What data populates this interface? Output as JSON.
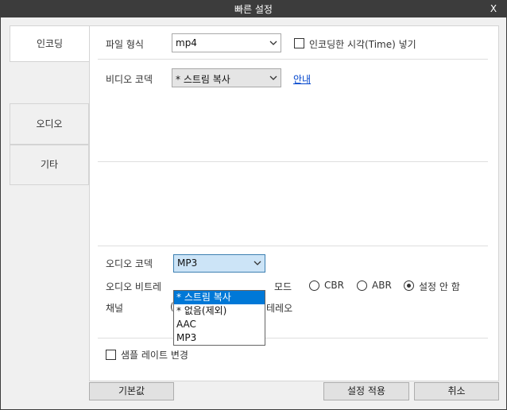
{
  "window": {
    "title": "빠른 설정",
    "close_label": "X"
  },
  "tabs": {
    "encoding": "인코딩",
    "audio": "오디오",
    "other": "기타"
  },
  "encoding": {
    "file_format_label": "파일 형식",
    "file_format_value": "mp4",
    "insert_time_label": "인코딩한 시각(Time) 넣기",
    "video_codec_label": "비디오 코덱",
    "video_codec_value": "* 스트림 복사",
    "guide_link": "안내"
  },
  "audio": {
    "codec_label": "오디오 코덱",
    "codec_value": "MP3",
    "codec_options": [
      "* 스트림 복사",
      "* 없음(제외)",
      "AAC",
      "MP3"
    ],
    "bitrate_label": "오디오 비트레",
    "mode_label": "모드",
    "mode_options": {
      "cbr": "CBR",
      "abr": "ABR",
      "none": "설정 안 함"
    },
    "mode_selected": "설정 안 함",
    "channel_label": "채널",
    "channel_fragment_left": "(",
    "channel_fragment_right": "테레오",
    "samplerate_label": "샘플 레이트 변경"
  },
  "buttons": {
    "default": "기본값",
    "apply": "설정 적용",
    "cancel": "취소"
  }
}
